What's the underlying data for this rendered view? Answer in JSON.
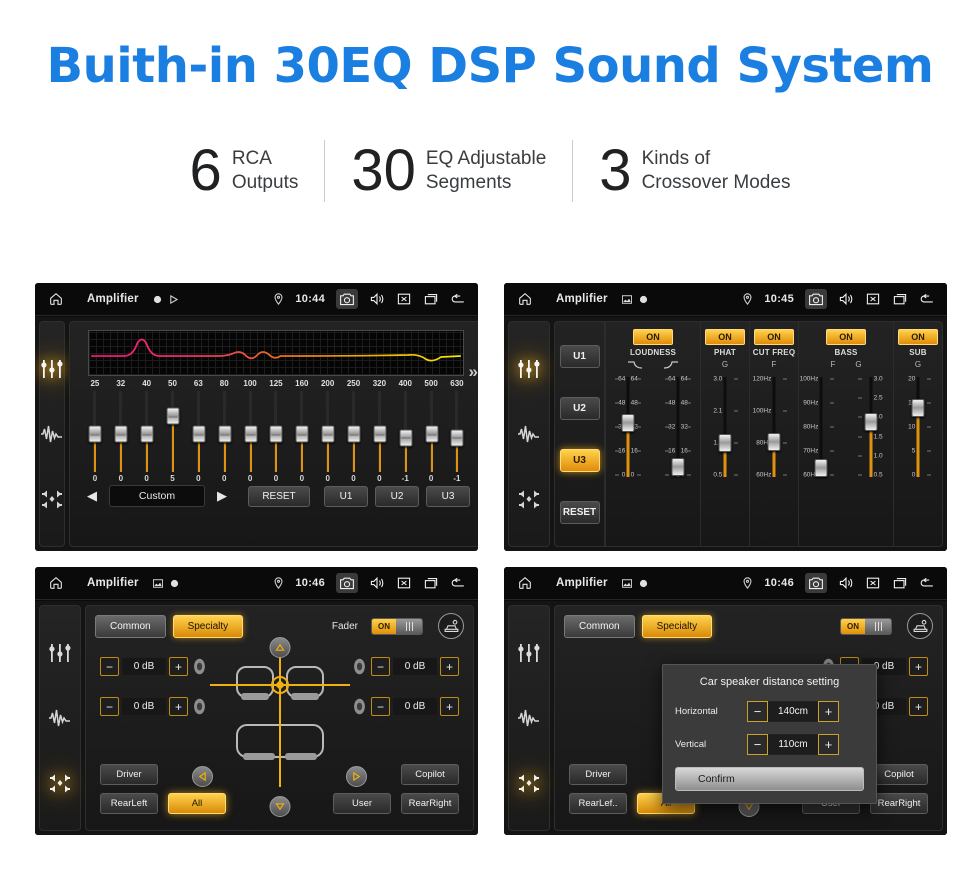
{
  "header": {
    "title": "Buith-in 30EQ DSP Sound System",
    "title_color": "#1a7fe0",
    "stats": [
      {
        "number": "6",
        "text": "RCA\nOutputs"
      },
      {
        "number": "30",
        "text": "EQ Adjustable\nSegments"
      },
      {
        "number": "3",
        "text": "Kinds of\nCrossover Modes"
      }
    ]
  },
  "accent": {
    "gold": "#e8a70d",
    "gold_light": "#ffd24d",
    "blue": "#1a7fe0"
  },
  "screens": {
    "eq": {
      "statusbar": {
        "app_title": "Amplifier",
        "time": "10:44",
        "icons": [
          "home-icon",
          "record-icon",
          "play-icon",
          "location-icon",
          "camera-icon",
          "volume-icon",
          "close-icon",
          "recents-icon",
          "back-icon"
        ]
      },
      "rail": [
        {
          "name": "equalizer-icon",
          "active": true
        },
        {
          "name": "waveform-icon",
          "active": false
        },
        {
          "name": "balance-icon",
          "active": false
        }
      ],
      "frequencies": [
        "25",
        "32",
        "40",
        "50",
        "63",
        "80",
        "100",
        "125",
        "160",
        "200",
        "250",
        "320",
        "400",
        "500",
        "630"
      ],
      "values": [
        0,
        0,
        0,
        5,
        0,
        0,
        0,
        0,
        0,
        0,
        0,
        0,
        -1,
        0,
        -1
      ],
      "more_glyph": "»",
      "preset": "Custom",
      "prev_glyph": "◀",
      "next_glyph": "▶",
      "buttons": [
        "RESET",
        "U1",
        "U2",
        "U3"
      ]
    },
    "dsp": {
      "statusbar": {
        "app_title": "Amplifier",
        "time": "10:45"
      },
      "rail": [
        {
          "name": "equalizer-icon",
          "active": true
        },
        {
          "name": "waveform-icon",
          "active": false
        },
        {
          "name": "balance-icon",
          "active": false
        }
      ],
      "user_presets": [
        {
          "label": "U1",
          "active": false
        },
        {
          "label": "U2",
          "active": false
        },
        {
          "label": "U3",
          "active": true
        },
        {
          "label": "RESET",
          "active": false
        }
      ],
      "columns": [
        {
          "label": "LOUDNESS",
          "state": "ON",
          "sub": [
            "curve-down-icon",
            "curve-up-icon"
          ],
          "sliders": [
            {
              "unit": "",
              "ticks": [
                "64",
                "48",
                "32",
                "16",
                "0"
              ],
              "value_pos": 0.46,
              "side": "both"
            },
            {
              "unit": "",
              "ticks": [
                "64",
                "48",
                "32",
                "16",
                "0"
              ],
              "value_pos": 0.92,
              "side": "both"
            }
          ]
        },
        {
          "label": "PHAT",
          "state": "ON",
          "sub": [
            "G"
          ],
          "sliders": [
            {
              "unit": "G",
              "ticks": [
                "3.0",
                "2.1",
                "1.3",
                "0.5"
              ],
              "value_pos": 0.67,
              "side": "left"
            }
          ]
        },
        {
          "label": "CUT FREQ",
          "state": "ON",
          "sub": [
            "F"
          ],
          "sliders": [
            {
              "unit": "F",
              "ticks": [
                "120Hz",
                "100Hz",
                "80Hz",
                "60Hz"
              ],
              "value_pos": 0.66,
              "side": "left"
            }
          ]
        },
        {
          "label": "BASS",
          "state": "ON",
          "sub": [
            "F",
            "G"
          ],
          "sliders": [
            {
              "unit": "F",
              "ticks": [
                "100Hz",
                "90Hz",
                "80Hz",
                "70Hz",
                "60Hz"
              ],
              "value_pos": 0.93,
              "side": "left"
            },
            {
              "unit": "G",
              "ticks": [
                "3.0",
                "2.5",
                "2.0",
                "1.5",
                "1.0",
                "0.5"
              ],
              "value_pos": 0.45,
              "side": "right"
            }
          ]
        },
        {
          "label": "SUB",
          "state": "ON",
          "sub": [
            "G"
          ],
          "sliders": [
            {
              "unit": "G",
              "ticks": [
                "20",
                "15",
                "10",
                "5",
                "0"
              ],
              "value_pos": 0.3,
              "side": "left"
            }
          ]
        }
      ]
    },
    "fader": {
      "statusbar": {
        "app_title": "Amplifier",
        "time": "10:46"
      },
      "rail": [
        {
          "name": "equalizer-icon",
          "active": false
        },
        {
          "name": "waveform-icon",
          "active": false
        },
        {
          "name": "balance-icon",
          "active": true
        }
      ],
      "tabs": [
        {
          "label": "Common",
          "active": false
        },
        {
          "label": "Specialty",
          "active": true
        }
      ],
      "fader_label": "Fader",
      "fader_state": "ON",
      "car_settings_icon": "car-settings-icon",
      "db_left": [
        "0 dB",
        "0 dB"
      ],
      "db_right": [
        "0 dB",
        "0 dB"
      ],
      "minus_glyph": "−",
      "plus_glyph": "+",
      "seat_buttons": [
        {
          "label": "Driver",
          "active": false
        },
        {
          "label": "Copilot",
          "active": false
        },
        {
          "label": "RearLeft",
          "active": false
        },
        {
          "label": "All",
          "active": true
        },
        {
          "label": "User",
          "active": false
        },
        {
          "label": "RearRight",
          "active": false
        }
      ],
      "dpad": [
        "up-arrow-icon",
        "left-arrow-icon",
        "right-arrow-icon",
        "down-arrow-icon"
      ]
    },
    "dialog_screen": {
      "statusbar": {
        "app_title": "Amplifier",
        "time": "10:46"
      },
      "rail": [
        {
          "name": "equalizer-icon",
          "active": false
        },
        {
          "name": "waveform-icon",
          "active": false
        },
        {
          "name": "balance-icon",
          "active": true
        }
      ],
      "tabs": [
        {
          "label": "Common",
          "active": false
        },
        {
          "label": "Specialty",
          "active": true
        }
      ],
      "fader_state": "ON",
      "seat_buttons": [
        {
          "label": "Driver",
          "active": false
        },
        {
          "label": "Copilot",
          "active": false
        },
        {
          "label": "RearLef..",
          "active": false
        },
        {
          "label": "All",
          "active": true
        },
        {
          "label": "User",
          "active": false
        },
        {
          "label": "RearRight",
          "active": false
        }
      ],
      "db_right": [
        "0 dB",
        "0 dB"
      ],
      "dialog": {
        "title": "Car speaker distance setting",
        "rows": [
          {
            "label": "Horizontal",
            "value": "140cm"
          },
          {
            "label": "Vertical",
            "value": "110cm"
          }
        ],
        "minus_glyph": "−",
        "plus_glyph": "+",
        "confirm_label": "Confirm"
      }
    }
  }
}
